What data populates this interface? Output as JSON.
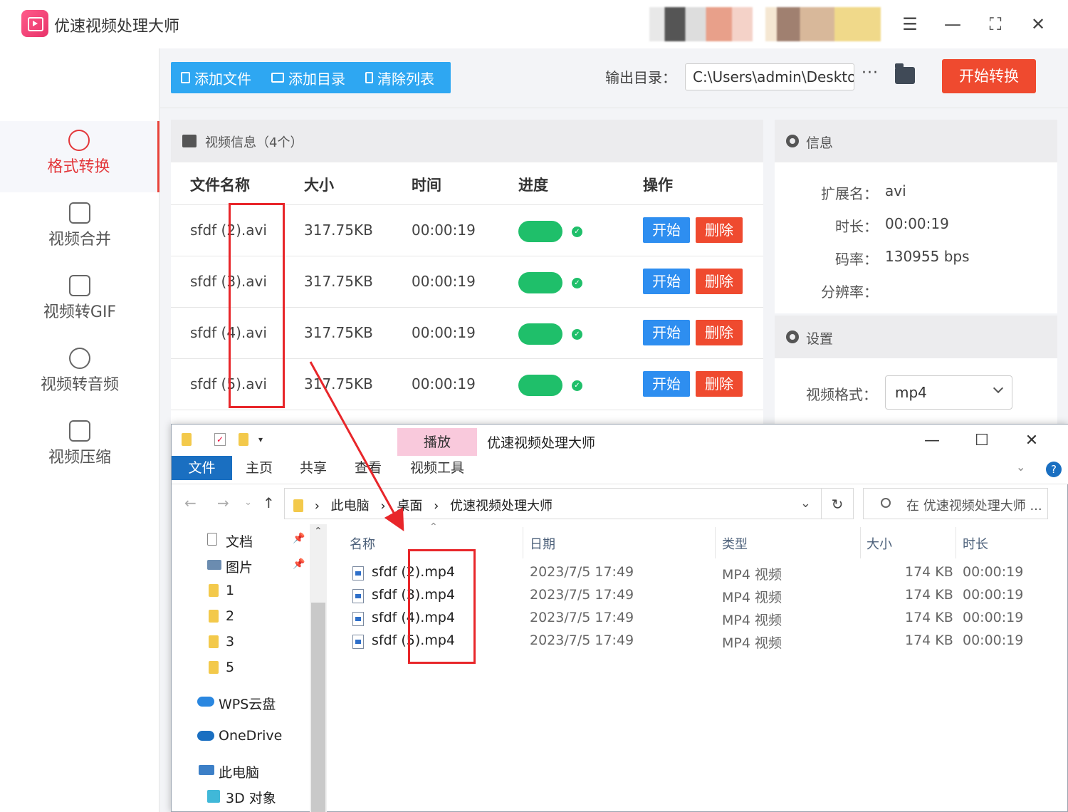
{
  "app": {
    "title": "优速视频处理大师"
  },
  "sidebar": {
    "items": [
      {
        "label": "格式转换",
        "icon": "format-convert-icon"
      },
      {
        "label": "视频合并",
        "icon": "merge-icon"
      },
      {
        "label": "视频转GIF",
        "icon": "gif-icon"
      },
      {
        "label": "视频转音频",
        "icon": "audio-icon"
      },
      {
        "label": "视频压缩",
        "icon": "compress-icon"
      }
    ]
  },
  "toolbar": {
    "add_file": "添加文件",
    "add_dir": "添加目录",
    "clear_list": "清除列表",
    "output_label": "输出目录：",
    "output_path": "C:\\Users\\admin\\Deskto",
    "more": "···",
    "start_convert": "开始转换"
  },
  "video_list": {
    "header": "视频信息（4个）",
    "columns": [
      "文件名称",
      "大小",
      "时间",
      "进度",
      "操作"
    ],
    "start_label": "开始",
    "delete_label": "删除",
    "rows": [
      {
        "name": "sfdf (2).avi",
        "size": "317.75KB",
        "time": "00:00:19"
      },
      {
        "name": "sfdf (3).avi",
        "size": "317.75KB",
        "time": "00:00:19"
      },
      {
        "name": "sfdf (4).avi",
        "size": "317.75KB",
        "time": "00:00:19"
      },
      {
        "name": "sfdf (5).avi",
        "size": "317.75KB",
        "time": "00:00:19"
      }
    ]
  },
  "info": {
    "header": "信息",
    "ext_label": "扩展名：",
    "ext_value": "avi",
    "duration_label": "时长：",
    "duration_value": "00:00:19",
    "bitrate_label": "码率：",
    "bitrate_value": "130955 bps",
    "resolution_label": "分辨率："
  },
  "settings": {
    "header": "设置",
    "format_label": "视频格式：",
    "format_value": "mp4"
  },
  "explorer": {
    "ctx_tab": "播放",
    "window_title": "优速视频处理大师",
    "ribbon": {
      "file": "文件",
      "home": "主页",
      "share": "共享",
      "view": "查看",
      "video_tools": "视频工具"
    },
    "breadcrumb": [
      "此电脑",
      "桌面",
      "优速视频处理大师"
    ],
    "search_placeholder": "在 优速视频处理大师 ...",
    "tree": [
      {
        "label": "文档"
      },
      {
        "label": "图片"
      },
      {
        "label": "1"
      },
      {
        "label": "2"
      },
      {
        "label": "3"
      },
      {
        "label": "5"
      },
      {
        "label": "WPS云盘"
      },
      {
        "label": "OneDrive"
      },
      {
        "label": "此电脑"
      },
      {
        "label": "3D 对象"
      }
    ],
    "columns": {
      "name": "名称",
      "date": "日期",
      "type": "类型",
      "size": "大小",
      "duration": "时长"
    },
    "files": [
      {
        "name": "sfdf (2).mp4",
        "date": "2023/7/5 17:49",
        "type": "MP4 视频",
        "size": "174 KB",
        "duration": "00:00:19"
      },
      {
        "name": "sfdf (3).mp4",
        "date": "2023/7/5 17:49",
        "type": "MP4 视频",
        "size": "174 KB",
        "duration": "00:00:19"
      },
      {
        "name": "sfdf (4).mp4",
        "date": "2023/7/5 17:49",
        "type": "MP4 视频",
        "size": "174 KB",
        "duration": "00:00:19"
      },
      {
        "name": "sfdf (5).mp4",
        "date": "2023/7/5 17:49",
        "type": "MP4 视频",
        "size": "174 KB",
        "duration": "00:00:19"
      }
    ]
  },
  "colors": {
    "accent_red": "#ef4a2f",
    "accent_blue": "#2ea7f2",
    "progress_green": "#1fbf6a",
    "annotation_red": "#e8262a"
  }
}
